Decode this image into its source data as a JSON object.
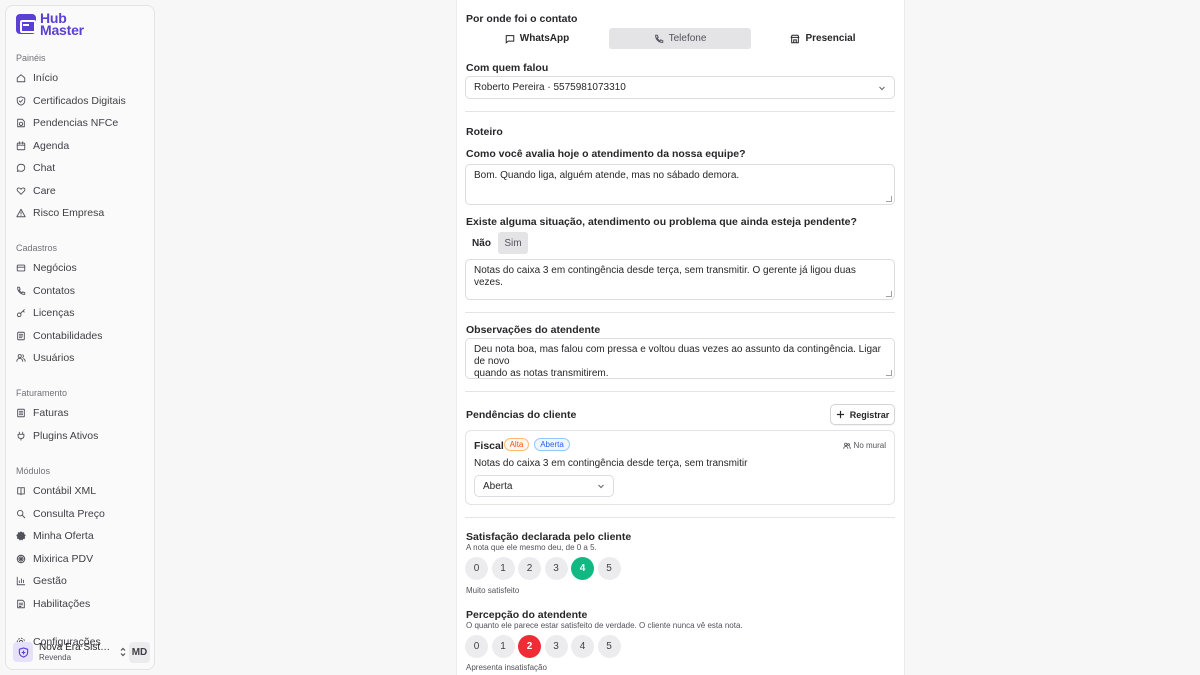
{
  "app": {
    "logo_line1": "Hub",
    "logo_line2": "Master"
  },
  "sidebar": {
    "groups": [
      {
        "title": "Painéis",
        "items": [
          {
            "label": "Início",
            "icon": "home-icon"
          },
          {
            "label": "Certificados Digitais",
            "icon": "shield-check-icon"
          },
          {
            "label": "Pendencias NFCe",
            "icon": "file-clock-icon"
          },
          {
            "label": "Agenda",
            "icon": "calendar-icon"
          },
          {
            "label": "Chat",
            "icon": "chat-icon"
          },
          {
            "label": "Care",
            "icon": "heart-icon"
          },
          {
            "label": "Risco Empresa",
            "icon": "warning-icon"
          }
        ]
      },
      {
        "title": "Cadastros",
        "items": [
          {
            "label": "Negócios",
            "icon": "card-icon"
          },
          {
            "label": "Contatos",
            "icon": "phone-icon"
          },
          {
            "label": "Licenças",
            "icon": "key-icon"
          },
          {
            "label": "Contabilidades",
            "icon": "ledger-icon"
          },
          {
            "label": "Usuários",
            "icon": "users-icon"
          }
        ]
      },
      {
        "title": "Faturamento",
        "items": [
          {
            "label": "Faturas",
            "icon": "invoice-icon"
          },
          {
            "label": "Plugins Ativos",
            "icon": "plug-icon"
          }
        ]
      },
      {
        "title": "Módulos",
        "items": [
          {
            "label": "Contábil XML",
            "icon": "book-icon"
          },
          {
            "label": "Consulta Preço",
            "icon": "search-icon"
          },
          {
            "label": "Minha Oferta",
            "icon": "badge-icon"
          },
          {
            "label": "Mixirica PDV",
            "icon": "citrus-icon"
          },
          {
            "label": "Gestão",
            "icon": "bar-chart-icon"
          },
          {
            "label": "Habilitações",
            "icon": "id-card-icon"
          }
        ]
      }
    ],
    "settings_label": "Configurações",
    "org": {
      "name": "Nova Era Sistemas",
      "role": "Revenda"
    },
    "user_initials": "MD"
  },
  "form": {
    "contact_channel": {
      "label": "Por onde foi o contato",
      "options": [
        "WhatsApp",
        "Telefone",
        "Presencial"
      ],
      "selected": "Telefone"
    },
    "contact_person": {
      "label": "Com quem falou",
      "value": "Roberto Pereira · 5575981073310"
    },
    "script_title": "Roteiro",
    "q1": {
      "label": "Como você avalia hoje o atendimento da nossa equipe?",
      "answer": "Bom. Quando liga, alguém atende, mas no sábado demora."
    },
    "q2": {
      "label": "Existe alguma situação, atendimento ou problema que ainda esteja pendente?",
      "options": [
        "Não",
        "Sim"
      ],
      "selected": "Sim",
      "answer": "Notas do caixa 3 em contingência desde terça, sem transmitir. O gerente já ligou duas vezes."
    },
    "observations": {
      "label": "Observações do atendente",
      "line1": "Deu nota boa, mas falou com pressa e voltou duas vezes ao assunto da contingência. Ligar de novo",
      "line2": "quando as notas transmitirem."
    },
    "pendencias": {
      "title": "Pendências do cliente",
      "register_label": "Registrar",
      "items": [
        {
          "category": "Fiscal",
          "priority": "Alta",
          "status_badge": "Aberta",
          "mural": "No mural",
          "description": "Notas do caixa 3 em contingência desde terça, sem transmitir",
          "status_select": "Aberta"
        }
      ]
    },
    "satisfaction": {
      "title": "Satisfação declarada pelo cliente",
      "subtitle": "A nota que ele mesmo deu, de 0 a 5.",
      "scale": [
        "0",
        "1",
        "2",
        "3",
        "4",
        "5"
      ],
      "selected": 4,
      "caption": "Muito satisfeito"
    },
    "perception": {
      "title": "Percepção do atendente",
      "subtitle": "O quanto ele parece estar satisfeito de verdade. O cliente nunca vê esta nota.",
      "scale": [
        "0",
        "1",
        "2",
        "3",
        "4",
        "5"
      ],
      "selected": 2,
      "caption": "Apresenta insatisfação"
    }
  },
  "colors": {
    "brand": "#5b3fd4",
    "green": "#10b981",
    "red": "#ef2b35",
    "alta": "#f97316",
    "aberta": "#2563eb"
  }
}
